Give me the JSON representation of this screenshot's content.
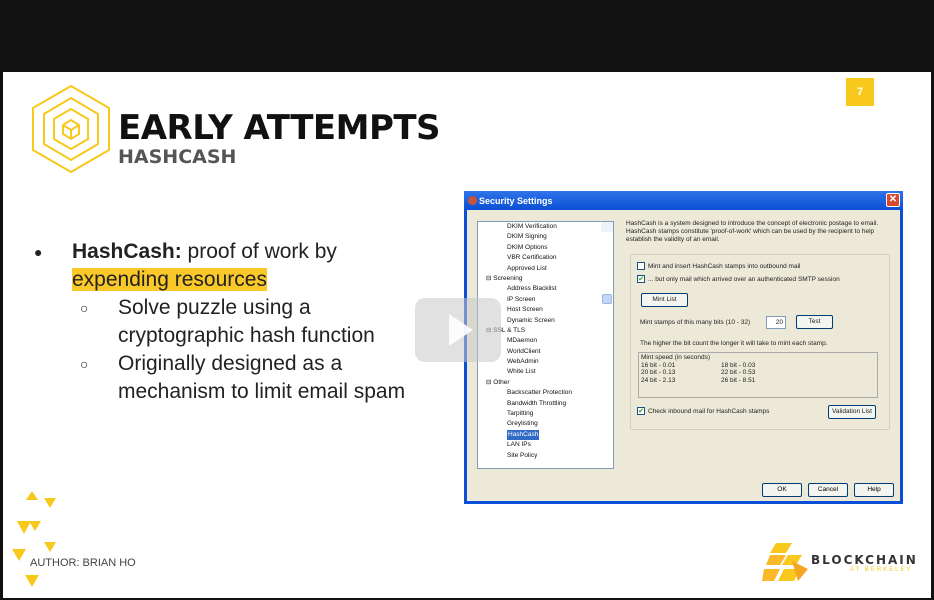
{
  "slide": {
    "page_number": "7",
    "title": "EARLY ATTEMPTS",
    "subtitle": "HASHCASH",
    "author": "AUTHOR: BRIAN HO",
    "brand": {
      "name": "BLOCKCHAIN",
      "sub": "AT BERKELEY"
    },
    "bullets": [
      {
        "bold": "HashCash:",
        "text": " proof of work by",
        "highlight": "expending resources"
      }
    ],
    "sub_bullets": [
      "Solve puzzle using a cryptographic hash function",
      "Originally designed as a mechanism to limit email spam"
    ],
    "accent": "#f8c81c"
  },
  "dialog": {
    "title": "Security Settings",
    "close": "✕",
    "tree": [
      {
        "t": "DKIM Verification",
        "k": "c"
      },
      {
        "t": "DKIM Signing",
        "k": "c"
      },
      {
        "t": "DKIM Options",
        "k": "c"
      },
      {
        "t": "VBR Certification",
        "k": "c"
      },
      {
        "t": "Approved List",
        "k": "c"
      },
      {
        "t": "Screening",
        "k": "p"
      },
      {
        "t": "Address Blacklist",
        "k": "c"
      },
      {
        "t": "IP Screen",
        "k": "c"
      },
      {
        "t": "Host Screen",
        "k": "c"
      },
      {
        "t": "Dynamic Screen",
        "k": "c"
      },
      {
        "t": "SSL & TLS",
        "k": "p"
      },
      {
        "t": "MDaemon",
        "k": "c"
      },
      {
        "t": "WorldClient",
        "k": "c"
      },
      {
        "t": "WebAdmin",
        "k": "c"
      },
      {
        "t": "White List",
        "k": "c"
      },
      {
        "t": "Other",
        "k": "p"
      },
      {
        "t": "Backscatter Protection",
        "k": "c"
      },
      {
        "t": "Bandwidth Throttling",
        "k": "c"
      },
      {
        "t": "Tarpitting",
        "k": "c"
      },
      {
        "t": "Greylisting",
        "k": "c"
      },
      {
        "t": "HashCash",
        "k": "c",
        "selected": true
      },
      {
        "t": "LAN IPs",
        "k": "c"
      },
      {
        "t": "Site Policy",
        "k": "c"
      }
    ],
    "description": "HashCash is a system designed to introduce the concept of electronic postage to email.  HashCash stamps constitute 'proof-of-work' which can be used by the recipient to help establish the validity of an email.",
    "mint_insert": {
      "label": "Mint and insert HashCash stamps into outbound mail",
      "checked": false
    },
    "only_auth": {
      "label": "... but only mail which arrived over an authenticated SMTP session",
      "checked": true
    },
    "mint_list": "Mint List",
    "bits_label": "Mint stamps of this many bits (10 - 32)",
    "bits_value": "20",
    "test": "Test",
    "note": "The higher the bit count the longer it will take to mint each stamp.",
    "speed_title": "Mint speed (in seconds)",
    "speeds": [
      "16 bit - 0.01",
      "18 bit - 0.03",
      "20 bit - 0.13",
      "22 bit - 0.53",
      "24 bit - 2.13",
      "26 bit - 8.51"
    ],
    "check_inbound": {
      "label": "Check inbound mail for HashCash stamps",
      "checked": true
    },
    "validation_list": "Validation List",
    "ok": "OK",
    "cancel": "Cancel",
    "help": "Help"
  }
}
